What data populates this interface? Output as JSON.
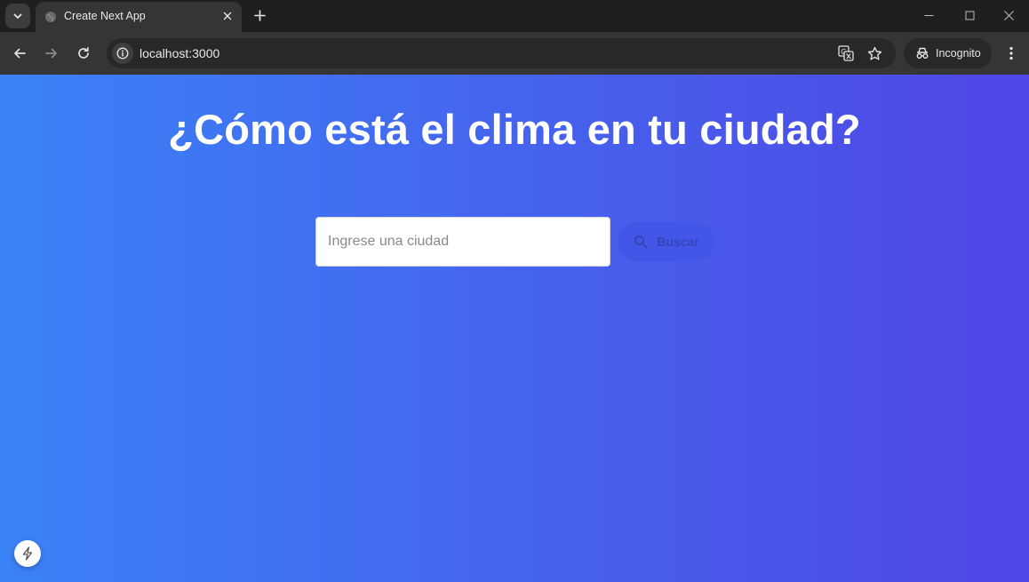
{
  "browser": {
    "tab_title": "Create Next App",
    "url": "localhost:3000",
    "incognito_label": "Incognito",
    "icons": [
      "tab-search-icon",
      "globe-icon",
      "close-icon",
      "plus-icon",
      "minimize-icon",
      "maximize-icon",
      "window-close-icon",
      "back-icon",
      "forward-icon",
      "reload-icon",
      "info-icon",
      "translate-icon",
      "star-icon",
      "incognito-icon",
      "more-vert-icon"
    ]
  },
  "page": {
    "heading": "¿Cómo está el clima en tu ciudad?",
    "search": {
      "placeholder": "Ingrese una ciudad",
      "value": "",
      "button_label": "Buscar"
    },
    "colors": {
      "gradient_start": "#3b82f6",
      "gradient_end": "#4f46e5",
      "button_bg": "#4256e8"
    }
  }
}
